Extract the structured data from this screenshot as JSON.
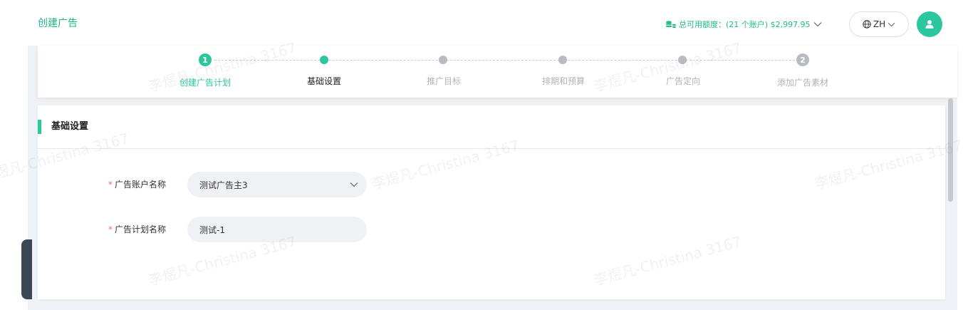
{
  "header": {
    "title": "创建广告",
    "quota_text": "总可用额度：(21 个账户)  $2,997.95",
    "language": "ZH"
  },
  "steps": [
    {
      "label": "创建广告计划",
      "marker": "1",
      "status": "done"
    },
    {
      "label": "基础设置",
      "marker": "",
      "status": "current"
    },
    {
      "label": "推广目标",
      "marker": "",
      "status": "pending"
    },
    {
      "label": "排期和预算",
      "marker": "",
      "status": "pending"
    },
    {
      "label": "广告定向",
      "marker": "",
      "status": "pending"
    },
    {
      "label": "添加广告素材",
      "marker": "2",
      "status": "pending"
    }
  ],
  "section": {
    "title": "基础设置",
    "fields": [
      {
        "required_mark": "*",
        "label": "广告账户名称",
        "value": "测试广告主3",
        "type": "select"
      },
      {
        "required_mark": "*",
        "label": "广告计划名称",
        "value": "测试-1",
        "type": "text"
      }
    ]
  },
  "watermark": "李煜凡-Christina 3167",
  "colors": {
    "accent": "#2cc79e",
    "accent_text": "#1fb98d",
    "required": "#f56c6c",
    "pending": "#b8bcc2",
    "page_bg": "#eef1f6"
  },
  "icons": [
    "coins-icon",
    "chevron-down-icon",
    "globe-icon",
    "user-icon"
  ]
}
